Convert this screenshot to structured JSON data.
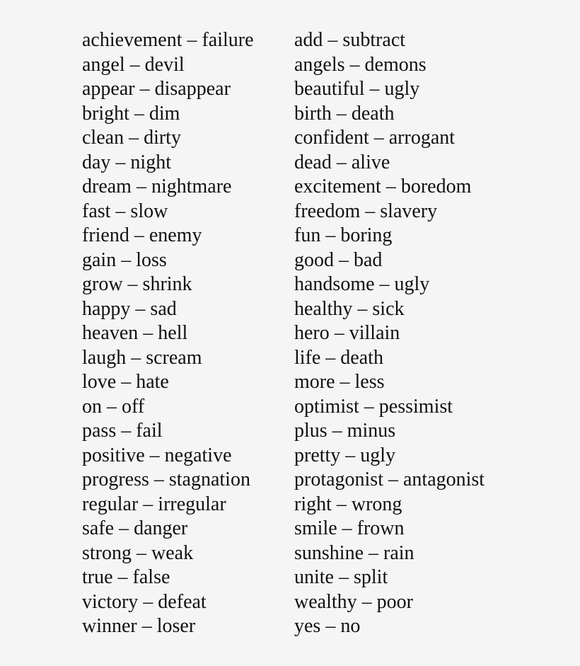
{
  "columns": [
    [
      "achievement – failure",
      "angel – devil",
      "appear – disappear",
      "bright – dim",
      "clean – dirty",
      "day – night",
      "dream – nightmare",
      "fast – slow",
      "friend – enemy",
      "gain – loss",
      "grow – shrink",
      "happy – sad",
      "heaven – hell",
      "laugh – scream",
      "love – hate",
      "on – off",
      "pass – fail",
      "positive – negative",
      "progress – stagnation",
      "regular – irregular",
      "safe – danger",
      "strong – weak",
      "true – false",
      "victory – defeat",
      "winner – loser"
    ],
    [
      "add – subtract",
      "angels – demons",
      "beautiful – ugly",
      "birth – death",
      "confident – arrogant",
      "dead – alive",
      "excitement – boredom",
      "freedom – slavery",
      "fun – boring",
      "good – bad",
      "handsome – ugly",
      "healthy – sick",
      "hero – villain",
      "life – death",
      "more – less",
      "optimist – pessimist",
      "plus – minus",
      "pretty – ugly",
      "protagonist – antagonist",
      "right – wrong",
      "smile – frown",
      "sunshine – rain",
      "unite – split",
      "wealthy – poor",
      "yes – no"
    ]
  ]
}
